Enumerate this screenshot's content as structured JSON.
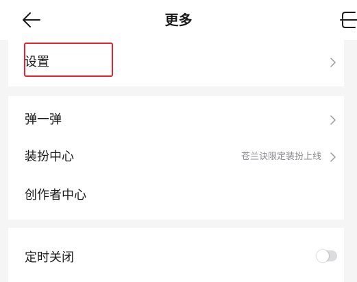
{
  "header": {
    "title": "更多",
    "back_icon": "arrow-left-icon",
    "scan_icon": "scan-icon"
  },
  "settings_group": {
    "items": [
      {
        "label": "设置",
        "chevron_icon": "chevron-right-icon"
      }
    ]
  },
  "features_group": {
    "items": [
      {
        "label": "弹一弹",
        "chevron_icon": "chevron-right-icon"
      },
      {
        "label": "装扮中心",
        "value": "苍兰诀限定装扮上线",
        "chevron_icon": "chevron-right-icon"
      },
      {
        "label": "创作者中心"
      }
    ]
  },
  "timer_group": {
    "items": [
      {
        "label": "定时关闭",
        "toggle_on": false
      }
    ]
  },
  "colors": {
    "background": "#f5f5f6",
    "card": "#ffffff",
    "text": "#1a1a1a",
    "secondary_text": "#8a8a8f",
    "highlight": "#e8202a",
    "toggle_off": "#dcdcde"
  }
}
